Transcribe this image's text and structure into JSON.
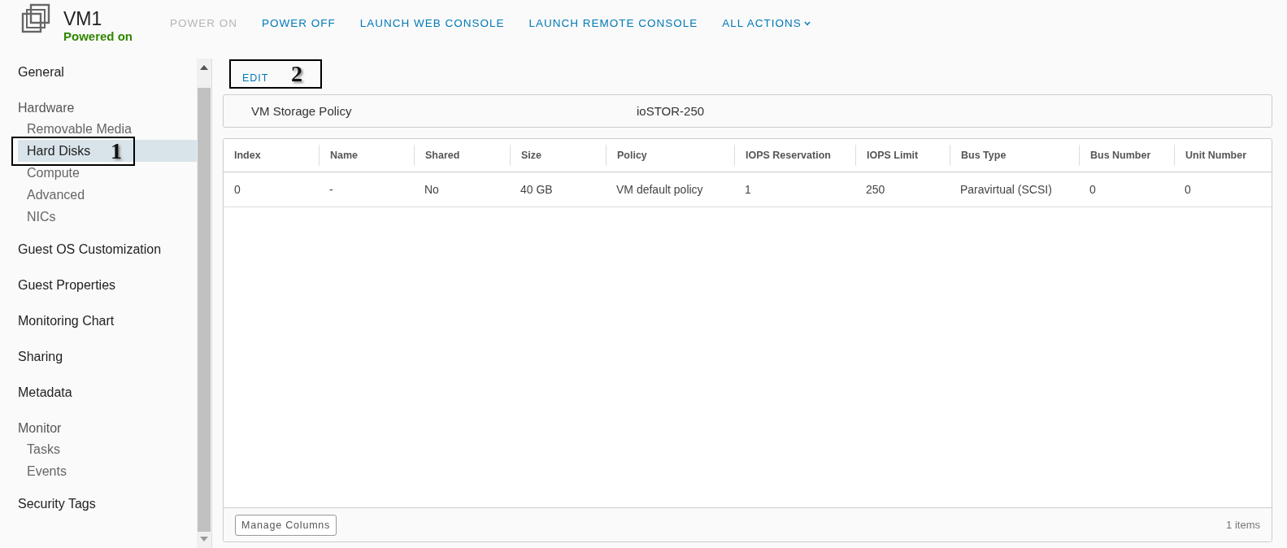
{
  "header": {
    "title": "VM1",
    "status": "Powered on",
    "actions": [
      {
        "label": "POWER ON",
        "disabled": true,
        "dropdown": false
      },
      {
        "label": "POWER OFF",
        "disabled": false,
        "dropdown": false
      },
      {
        "label": "LAUNCH WEB CONSOLE",
        "disabled": false,
        "dropdown": false
      },
      {
        "label": "LAUNCH REMOTE CONSOLE",
        "disabled": false,
        "dropdown": false
      },
      {
        "label": "ALL ACTIONS",
        "disabled": false,
        "dropdown": true
      }
    ]
  },
  "sidebar": {
    "items": [
      {
        "label": "General",
        "selected": false
      },
      {
        "label": "Hardware",
        "selected": false,
        "children": [
          {
            "label": "Removable Media",
            "selected": false
          },
          {
            "label": "Hard Disks",
            "selected": true,
            "callout": "1"
          },
          {
            "label": "Compute",
            "selected": false
          },
          {
            "label": "Advanced",
            "selected": false
          },
          {
            "label": "NICs",
            "selected": false
          }
        ]
      },
      {
        "label": "Guest OS Customization",
        "selected": false
      },
      {
        "label": "Guest Properties",
        "selected": false
      },
      {
        "label": "Monitoring Chart",
        "selected": false
      },
      {
        "label": "Sharing",
        "selected": false
      },
      {
        "label": "Metadata",
        "selected": false
      },
      {
        "label": "Monitor",
        "selected": false,
        "children": [
          {
            "label": "Tasks",
            "selected": false
          },
          {
            "label": "Events",
            "selected": false
          }
        ]
      },
      {
        "label": "Security Tags",
        "selected": false
      }
    ]
  },
  "edit_button": {
    "label": "EDIT",
    "callout": "2"
  },
  "policy": {
    "label": "VM Storage Policy",
    "value": "ioSTOR-250"
  },
  "table": {
    "columns": [
      "Index",
      "Name",
      "Shared",
      "Size",
      "Policy",
      "IOPS Reservation",
      "IOPS Limit",
      "Bus Type",
      "Bus Number",
      "Unit Number"
    ],
    "rows": [
      [
        "0",
        "-",
        "No",
        "40 GB",
        "VM default policy",
        "1",
        "250",
        "Paravirtual (SCSI)",
        "0",
        "0"
      ]
    ]
  },
  "footer": {
    "button": "Manage Columns",
    "count": "1 items"
  }
}
